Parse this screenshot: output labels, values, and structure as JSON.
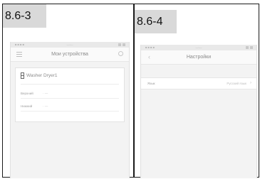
{
  "left_figure": {
    "label": "8.6-3",
    "statusbar": {
      "left": "■ ■ ■ ■",
      "center": "—:—",
      "right": ""
    },
    "header": {
      "title": "Мои устройства"
    },
    "device": {
      "name": "Washer Dryer1",
      "drums": [
        {
          "name": "Верхний",
          "value": "·  —"
        },
        {
          "name": "Нижний",
          "value": "·  —"
        }
      ]
    }
  },
  "right_figure": {
    "label": "8.6-4",
    "statusbar": {
      "left": "■ ■ ■ ■",
      "center": "—:—",
      "right": ""
    },
    "header": {
      "title": "Настройки"
    },
    "settings": [
      {
        "label": "Язык",
        "value": "Русский язык",
        "chevron": "›"
      }
    ]
  }
}
